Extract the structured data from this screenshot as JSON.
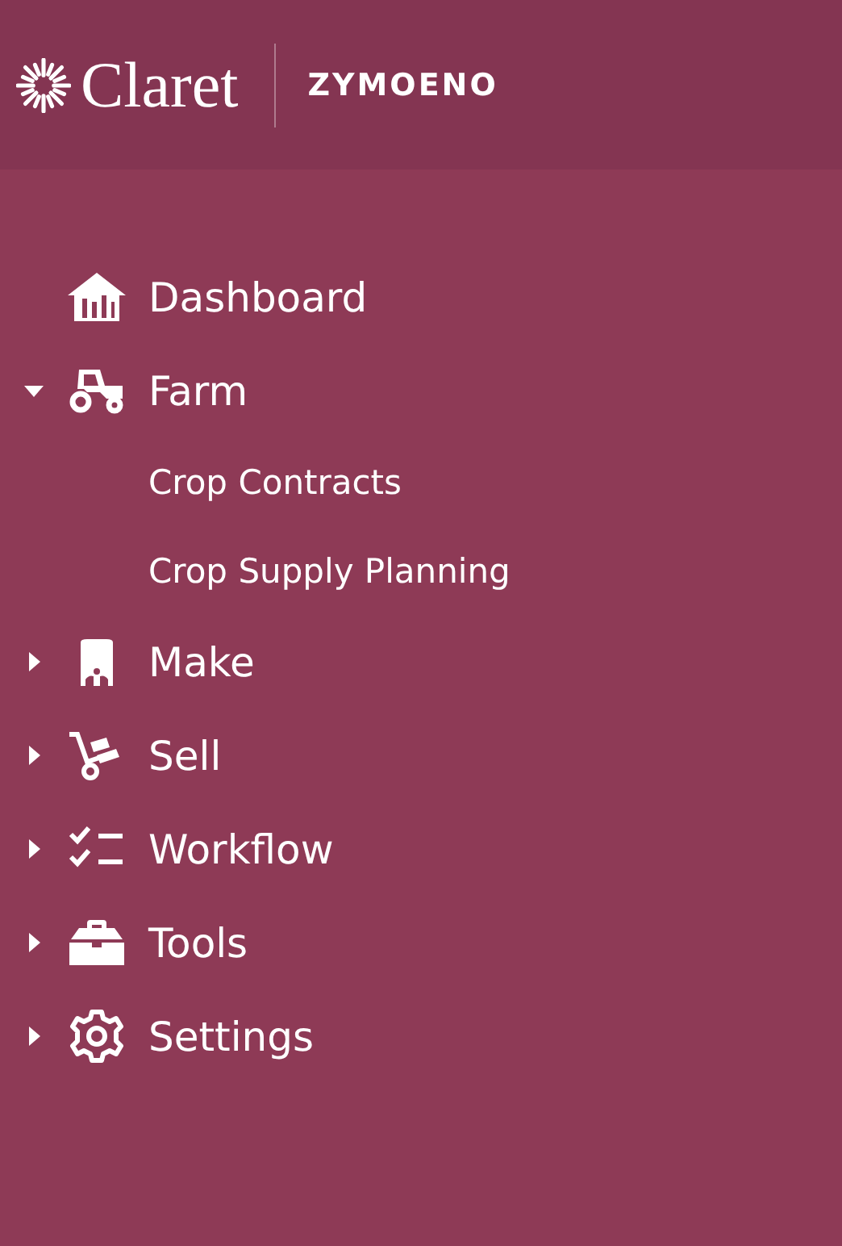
{
  "header": {
    "logo_text": "Claret",
    "organization": "ZYMOENO"
  },
  "sidebar": {
    "items": [
      {
        "label": "Dashboard"
      },
      {
        "label": "Farm",
        "expanded": true,
        "children": [
          {
            "label": "Crop Contracts"
          },
          {
            "label": "Crop Supply Planning"
          }
        ]
      },
      {
        "label": "Make",
        "expanded": false
      },
      {
        "label": "Sell",
        "expanded": false
      },
      {
        "label": "Workflow",
        "expanded": false
      },
      {
        "label": "Tools",
        "expanded": false
      },
      {
        "label": "Settings",
        "expanded": false
      }
    ]
  }
}
